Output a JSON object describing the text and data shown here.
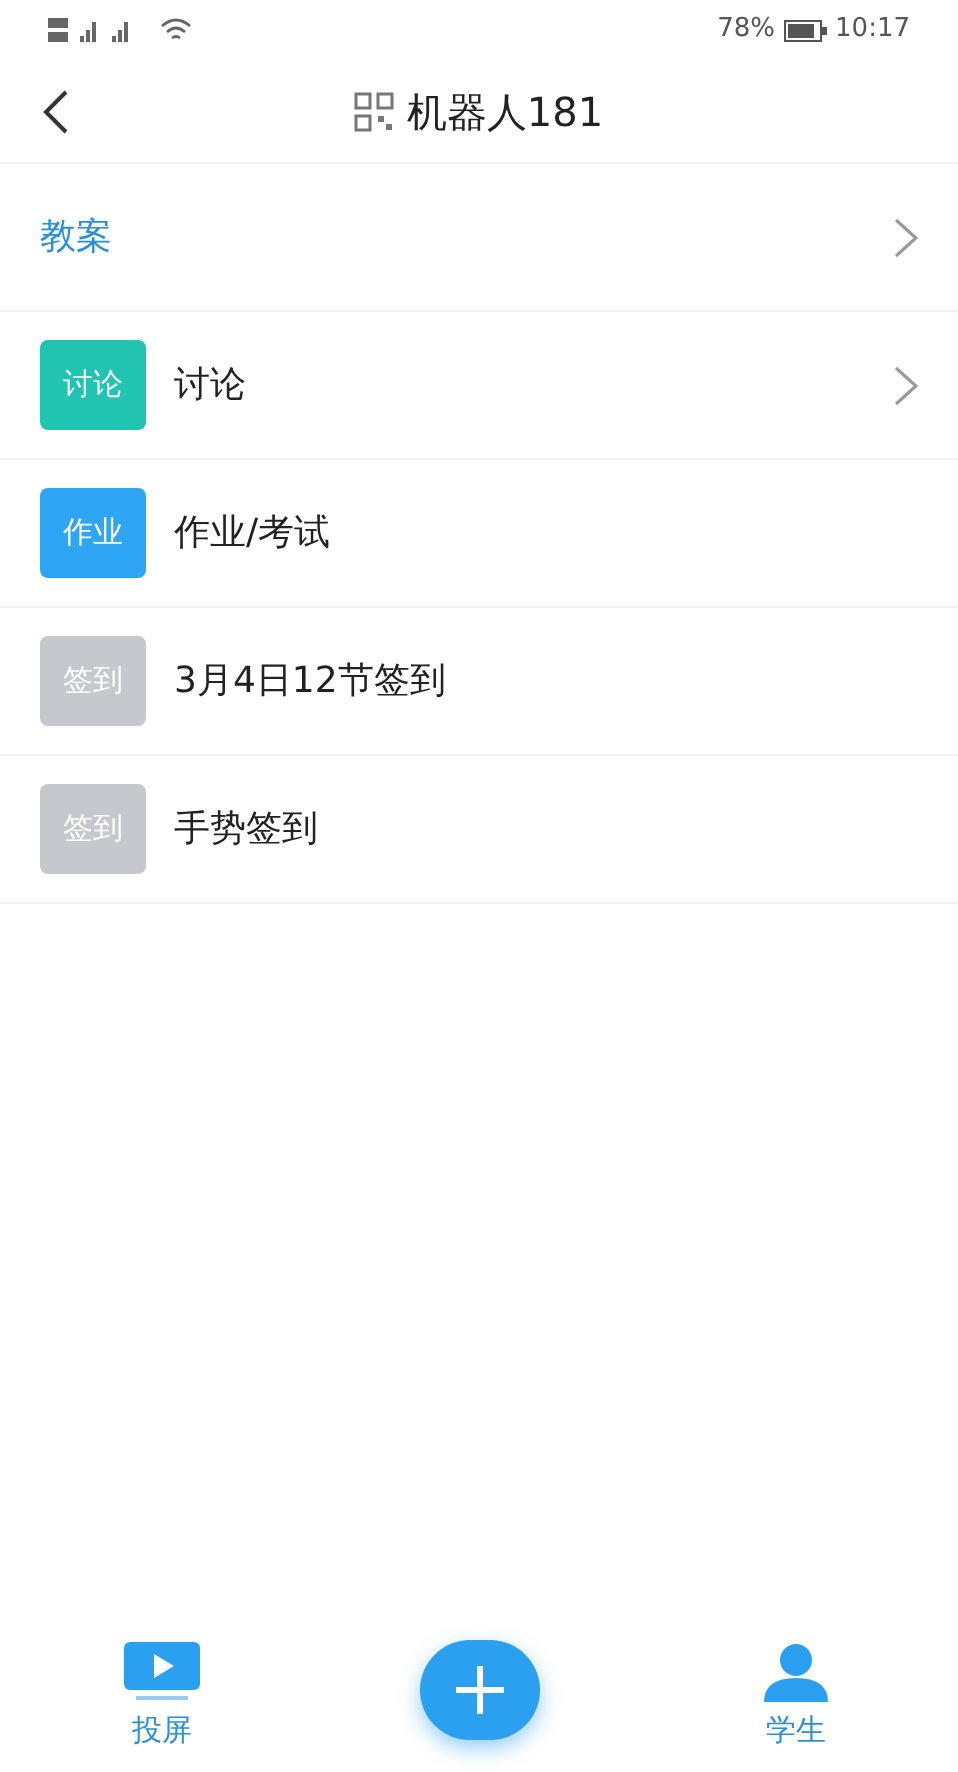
{
  "status_bar": {
    "battery": "78%",
    "time": "10:17"
  },
  "nav": {
    "title": "机器人181"
  },
  "items": [
    {
      "kind": "heading",
      "label": "教案",
      "chevron": true
    },
    {
      "kind": "badged",
      "badge": "讨论",
      "color": "#20c4b0",
      "label": "讨论",
      "chevron": true
    },
    {
      "kind": "badged",
      "badge": "作业",
      "color": "#2fa6f5",
      "label": "作业/考试",
      "chevron": false
    },
    {
      "kind": "badged",
      "badge": "签到",
      "color": "#c5c8cc",
      "label": "3月4日12节签到",
      "chevron": false
    },
    {
      "kind": "badged",
      "badge": "签到",
      "color": "#c5c8cc",
      "label": "手势签到",
      "chevron": false
    }
  ],
  "bottom_nav": {
    "left": "投屏",
    "right": "学生"
  }
}
